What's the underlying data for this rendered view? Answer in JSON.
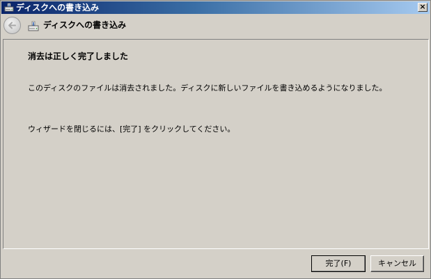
{
  "window": {
    "title": "ディスクへの書き込み",
    "close_label": "×"
  },
  "header": {
    "title": "ディスクへの書き込み"
  },
  "content": {
    "heading": "消去は正しく完了しました",
    "message1": "このディスクのファイルは消去されました。ディスクに新しいファイルを書き込めるようになりました。",
    "message2": "ウィザードを閉じるには、[完了] をクリックしてください。"
  },
  "buttons": {
    "finish_label": "完了(F)",
    "cancel_label": "キャンセル"
  },
  "icons": {
    "title": "disc-drive-icon",
    "back": "back-arrow-icon",
    "header": "disc-drive-icon"
  }
}
